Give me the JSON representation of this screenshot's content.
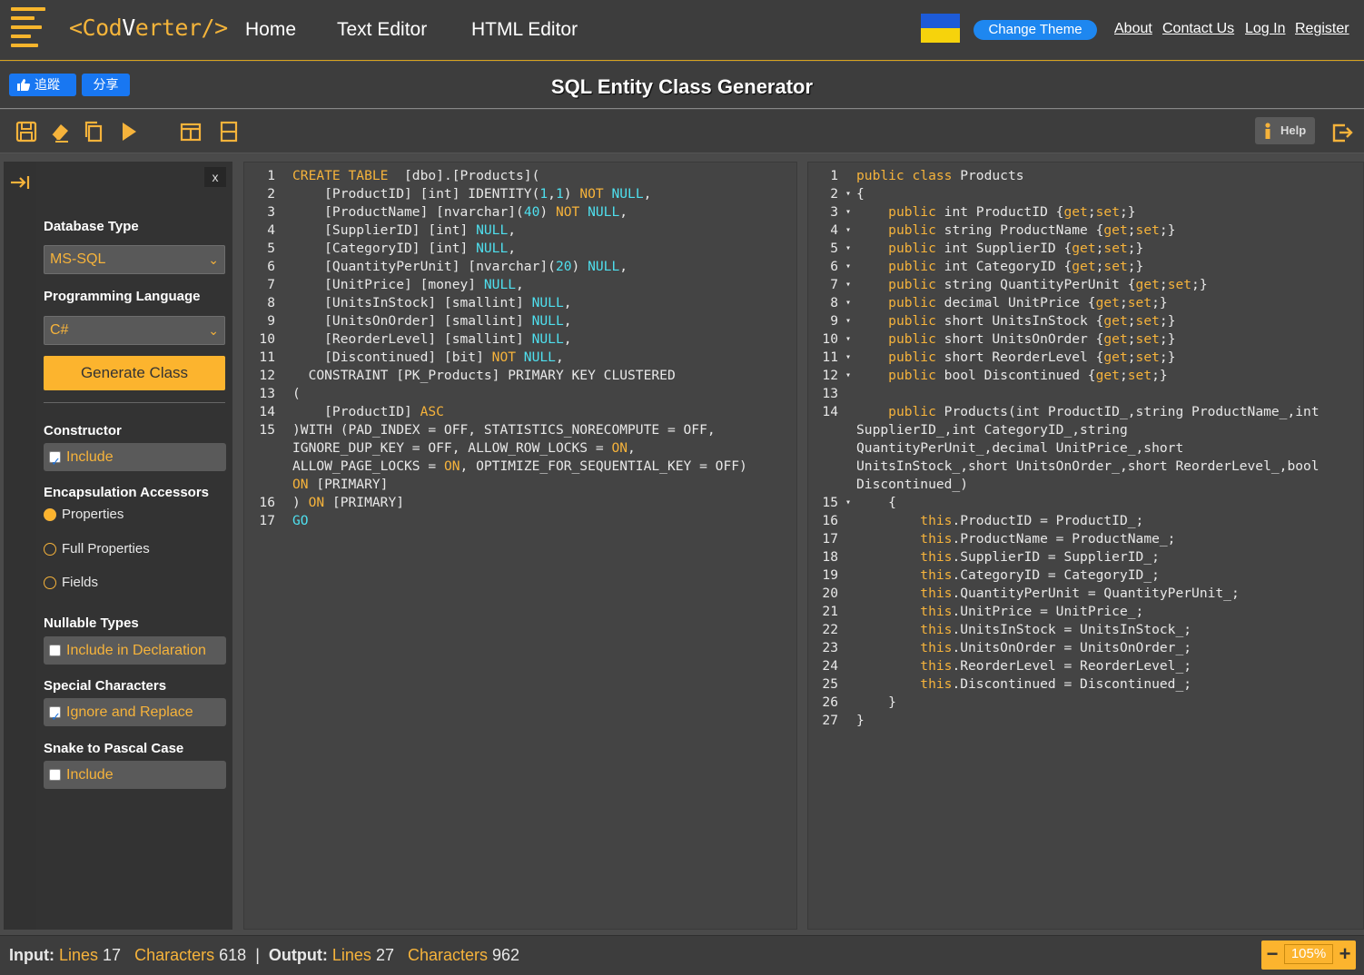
{
  "header": {
    "logo_text_pre": "<Cod",
    "logo_text_mid": "V",
    "logo_text_post": "erter/>",
    "nav": [
      "Home",
      "Text Editor",
      "HTML Editor"
    ],
    "change_theme": "Change Theme",
    "links": [
      "About",
      "Contact Us",
      "Log In",
      "Register"
    ]
  },
  "titlebar": {
    "fb_like": "追蹤",
    "fb_share": "分享",
    "title": "SQL Entity Class Generator"
  },
  "toolbar": {
    "help": "Help"
  },
  "sidebar": {
    "close": "x",
    "database_type_label": "Database Type",
    "database_type_value": "MS-SQL",
    "language_label": "Programming Language",
    "language_value": "C#",
    "generate_button": "Generate Class",
    "constructor_label": "Constructor",
    "constructor_include": "Include",
    "encapsulation_label": "Encapsulation Accessors",
    "encapsulation_options": [
      "Properties",
      "Full Properties",
      "Fields"
    ],
    "nullable_label": "Nullable Types",
    "nullable_include": "Include in Declaration",
    "special_label": "Special Characters",
    "special_include": "Ignore and Replace",
    "snake_label": "Snake to Pascal Case",
    "snake_include": "Include"
  },
  "input_editor": {
    "line_numbers": [
      "1",
      "2",
      "3",
      "4",
      "5",
      "6",
      "7",
      "8",
      "9",
      "10",
      "11",
      "12",
      "13",
      "14",
      "15",
      "",
      "",
      "",
      "16",
      "17"
    ],
    "lines": [
      [
        [
          "kw",
          "CREATE TABLE"
        ],
        [
          "",
          "  [dbo].[Products]("
        ]
      ],
      [
        [
          "",
          "    [ProductID] [int] IDENTITY("
        ],
        [
          "cy",
          "1"
        ],
        [
          "",
          ","
        ],
        [
          "cy",
          "1"
        ],
        [
          "",
          ") "
        ],
        [
          "kw",
          "NOT"
        ],
        [
          "cy",
          " NULL"
        ],
        [
          "",
          ","
        ]
      ],
      [
        [
          "",
          "    [ProductName] [nvarchar]("
        ],
        [
          "cy",
          "40"
        ],
        [
          "",
          ") "
        ],
        [
          "kw",
          "NOT"
        ],
        [
          "cy",
          " NULL"
        ],
        [
          "",
          ","
        ]
      ],
      [
        [
          "",
          "    [SupplierID] [int] "
        ],
        [
          "cy",
          "NULL"
        ],
        [
          "",
          ","
        ]
      ],
      [
        [
          "",
          "    [CategoryID] [int] "
        ],
        [
          "cy",
          "NULL"
        ],
        [
          "",
          ","
        ]
      ],
      [
        [
          "",
          "    [QuantityPerUnit] [nvarchar]("
        ],
        [
          "cy",
          "20"
        ],
        [
          "",
          ") "
        ],
        [
          "cy",
          "NULL"
        ],
        [
          "",
          ","
        ]
      ],
      [
        [
          "",
          "    [UnitPrice] [money] "
        ],
        [
          "cy",
          "NULL"
        ],
        [
          "",
          ","
        ]
      ],
      [
        [
          "",
          "    [UnitsInStock] [smallint] "
        ],
        [
          "cy",
          "NULL"
        ],
        [
          "",
          ","
        ]
      ],
      [
        [
          "",
          "    [UnitsOnOrder] [smallint] "
        ],
        [
          "cy",
          "NULL"
        ],
        [
          "",
          ","
        ]
      ],
      [
        [
          "",
          "    [ReorderLevel] [smallint] "
        ],
        [
          "cy",
          "NULL"
        ],
        [
          "",
          ","
        ]
      ],
      [
        [
          "",
          "    [Discontinued] [bit] "
        ],
        [
          "kw",
          "NOT"
        ],
        [
          "cy",
          " NULL"
        ],
        [
          "",
          ","
        ]
      ],
      [
        [
          "",
          "  CONSTRAINT [PK_Products] PRIMARY KEY CLUSTERED"
        ]
      ],
      [
        [
          "",
          "("
        ]
      ],
      [
        [
          "",
          "    [ProductID] "
        ],
        [
          "kw",
          "ASC"
        ]
      ],
      [
        [
          "",
          ")WITH (PAD_INDEX = OFF, STATISTICS_NORECOMPUTE = OFF,"
        ]
      ],
      [
        [
          "",
          "IGNORE_DUP_KEY = OFF, ALLOW_ROW_LOCKS = "
        ],
        [
          "kw",
          "ON"
        ],
        [
          "",
          ","
        ]
      ],
      [
        [
          "",
          "ALLOW_PAGE_LOCKS = "
        ],
        [
          "kw",
          "ON"
        ],
        [
          "",
          ", OPTIMIZE_FOR_SEQUENTIAL_KEY = OFF)"
        ]
      ],
      [
        [
          "kw",
          "ON"
        ],
        [
          "",
          " [PRIMARY]"
        ]
      ],
      [
        [
          "",
          ") "
        ],
        [
          "kw",
          "ON"
        ],
        [
          "",
          " [PRIMARY]"
        ]
      ],
      [
        [
          "cy",
          "GO"
        ]
      ]
    ]
  },
  "output_editor": {
    "line_numbers": [
      "1",
      "2",
      "3",
      "4",
      "5",
      "6",
      "7",
      "8",
      "9",
      "10",
      "11",
      "12",
      "13",
      "14",
      "",
      "",
      "",
      "",
      "15",
      "16",
      "17",
      "18",
      "19",
      "20",
      "21",
      "22",
      "23",
      "24",
      "25",
      "26",
      "27"
    ],
    "fold_lines": [
      1,
      2,
      3,
      4,
      5,
      6,
      7,
      8,
      9,
      10,
      11,
      18
    ],
    "lines": [
      [
        [
          "kw",
          "public class"
        ],
        [
          "",
          " Products"
        ]
      ],
      [
        [
          "",
          "{"
        ]
      ],
      [
        [
          "",
          "    "
        ],
        [
          "kw",
          "public"
        ],
        [
          "",
          " int ProductID {"
        ],
        [
          "kw",
          "get"
        ],
        [
          "",
          ";"
        ],
        [
          "kw",
          "set"
        ],
        [
          "",
          ";}"
        ]
      ],
      [
        [
          "",
          "    "
        ],
        [
          "kw",
          "public"
        ],
        [
          "",
          " string ProductName {"
        ],
        [
          "kw",
          "get"
        ],
        [
          "",
          ";"
        ],
        [
          "kw",
          "set"
        ],
        [
          "",
          ";}"
        ]
      ],
      [
        [
          "",
          "    "
        ],
        [
          "kw",
          "public"
        ],
        [
          "",
          " int SupplierID {"
        ],
        [
          "kw",
          "get"
        ],
        [
          "",
          ";"
        ],
        [
          "kw",
          "set"
        ],
        [
          "",
          ";}"
        ]
      ],
      [
        [
          "",
          "    "
        ],
        [
          "kw",
          "public"
        ],
        [
          "",
          " int CategoryID {"
        ],
        [
          "kw",
          "get"
        ],
        [
          "",
          ";"
        ],
        [
          "kw",
          "set"
        ],
        [
          "",
          ";}"
        ]
      ],
      [
        [
          "",
          "    "
        ],
        [
          "kw",
          "public"
        ],
        [
          "",
          " string QuantityPerUnit {"
        ],
        [
          "kw",
          "get"
        ],
        [
          "",
          ";"
        ],
        [
          "kw",
          "set"
        ],
        [
          "",
          ";}"
        ]
      ],
      [
        [
          "",
          "    "
        ],
        [
          "kw",
          "public"
        ],
        [
          "",
          " decimal UnitPrice {"
        ],
        [
          "kw",
          "get"
        ],
        [
          "",
          ";"
        ],
        [
          "kw",
          "set"
        ],
        [
          "",
          ";}"
        ]
      ],
      [
        [
          "",
          "    "
        ],
        [
          "kw",
          "public"
        ],
        [
          "",
          " short UnitsInStock {"
        ],
        [
          "kw",
          "get"
        ],
        [
          "",
          ";"
        ],
        [
          "kw",
          "set"
        ],
        [
          "",
          ";}"
        ]
      ],
      [
        [
          "",
          "    "
        ],
        [
          "kw",
          "public"
        ],
        [
          "",
          " short UnitsOnOrder {"
        ],
        [
          "kw",
          "get"
        ],
        [
          "",
          ";"
        ],
        [
          "kw",
          "set"
        ],
        [
          "",
          ";}"
        ]
      ],
      [
        [
          "",
          "    "
        ],
        [
          "kw",
          "public"
        ],
        [
          "",
          " short ReorderLevel {"
        ],
        [
          "kw",
          "get"
        ],
        [
          "",
          ";"
        ],
        [
          "kw",
          "set"
        ],
        [
          "",
          ";}"
        ]
      ],
      [
        [
          "",
          "    "
        ],
        [
          "kw",
          "public"
        ],
        [
          "",
          " bool Discontinued {"
        ],
        [
          "kw",
          "get"
        ],
        [
          "",
          ";"
        ],
        [
          "kw",
          "set"
        ],
        [
          "",
          ";}"
        ]
      ],
      [
        [
          "",
          ""
        ]
      ],
      [
        [
          "",
          "    "
        ],
        [
          "kw",
          "public"
        ],
        [
          "",
          " Products(int ProductID_,string ProductName_,int"
        ]
      ],
      [
        [
          "",
          "SupplierID_,int CategoryID_,string"
        ]
      ],
      [
        [
          "",
          "QuantityPerUnit_,decimal UnitPrice_,short"
        ]
      ],
      [
        [
          "",
          "UnitsInStock_,short UnitsOnOrder_,short ReorderLevel_,bool"
        ]
      ],
      [
        [
          "",
          "Discontinued_)"
        ]
      ],
      [
        [
          "",
          "    {"
        ]
      ],
      [
        [
          "",
          "        "
        ],
        [
          "kw",
          "this"
        ],
        [
          "",
          ".ProductID = ProductID_;"
        ]
      ],
      [
        [
          "",
          "        "
        ],
        [
          "kw",
          "this"
        ],
        [
          "",
          ".ProductName = ProductName_;"
        ]
      ],
      [
        [
          "",
          "        "
        ],
        [
          "kw",
          "this"
        ],
        [
          "",
          ".SupplierID = SupplierID_;"
        ]
      ],
      [
        [
          "",
          "        "
        ],
        [
          "kw",
          "this"
        ],
        [
          "",
          ".CategoryID = CategoryID_;"
        ]
      ],
      [
        [
          "",
          "        "
        ],
        [
          "kw",
          "this"
        ],
        [
          "",
          ".QuantityPerUnit = QuantityPerUnit_;"
        ]
      ],
      [
        [
          "",
          "        "
        ],
        [
          "kw",
          "this"
        ],
        [
          "",
          ".UnitPrice = UnitPrice_;"
        ]
      ],
      [
        [
          "",
          "        "
        ],
        [
          "kw",
          "this"
        ],
        [
          "",
          ".UnitsInStock = UnitsInStock_;"
        ]
      ],
      [
        [
          "",
          "        "
        ],
        [
          "kw",
          "this"
        ],
        [
          "",
          ".UnitsOnOrder = UnitsOnOrder_;"
        ]
      ],
      [
        [
          "",
          "        "
        ],
        [
          "kw",
          "this"
        ],
        [
          "",
          ".ReorderLevel = ReorderLevel_;"
        ]
      ],
      [
        [
          "",
          "        "
        ],
        [
          "kw",
          "this"
        ],
        [
          "",
          ".Discontinued = Discontinued_;"
        ]
      ],
      [
        [
          "",
          "    }"
        ]
      ],
      [
        [
          "",
          "}"
        ]
      ]
    ]
  },
  "status": {
    "input_label": "Input:",
    "lines_word": "Lines",
    "chars_word": "Characters",
    "input_lines": "17",
    "input_chars": "618",
    "sep": "|",
    "output_label": "Output:",
    "output_lines": "27",
    "output_chars": "962",
    "zoom": "105%",
    "zoom_minus": "−",
    "zoom_plus": "+"
  },
  "colors": {
    "accent": "#fcb42e",
    "keyword": "#f6b33b",
    "literal": "#4fe0ef",
    "theme_button": "#1e87f0",
    "flag_blue": "#1d5bd8",
    "flag_yellow": "#f6d30c"
  },
  "icons": {
    "toolbar": [
      "save-icon",
      "eraser-icon",
      "copy-icon",
      "run-icon",
      "layout-columns-icon",
      "layout-rows-icon"
    ],
    "help": "info-icon",
    "export": "export-icon",
    "sidebar_toggle": "collapse-arrow-icon"
  }
}
